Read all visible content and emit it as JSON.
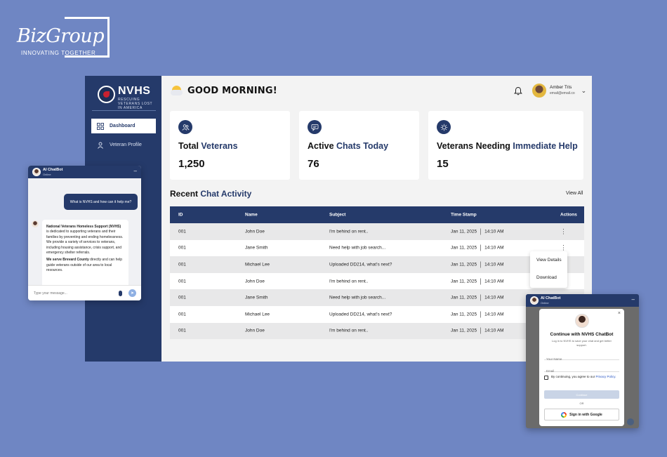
{
  "logo": {
    "brand": "BizGroup",
    "tagline": "INNOVATING TOGETHER"
  },
  "sidebar": {
    "org_name": "NVHS",
    "org_tagline": "RESCUING VETERANS LOST IN AMERICA",
    "items": [
      {
        "label": "Dashboard",
        "icon": "grid-icon",
        "active": true
      },
      {
        "label": "Veteran Profile",
        "icon": "person-icon",
        "active": false
      }
    ]
  },
  "header": {
    "greeting": "GOOD MORNING!",
    "user_name": "Amber Tris",
    "user_email": "email@email.co"
  },
  "cards": [
    {
      "label_plain": "Total ",
      "label_highlight": "Veterans",
      "value": "1,250",
      "icon": "people-icon"
    },
    {
      "label_plain": "Active ",
      "label_highlight": "Chats Today",
      "value": "76",
      "icon": "chat-icon"
    },
    {
      "label_plain": "Veterans Needing ",
      "label_highlight": "Immediate Help",
      "value": "15",
      "icon": "alert-icon"
    }
  ],
  "recent": {
    "title_plain": "Recent ",
    "title_highlight": "Chat Activity",
    "view_all": "View All"
  },
  "table": {
    "headers": {
      "id": "ID",
      "name": "Name",
      "subject": "Subject",
      "timestamp": "Time Stamp",
      "actions": "Actions"
    },
    "rows": [
      {
        "id": "001",
        "name": "John Doe",
        "subject": "I'm behind on rent..",
        "date": "Jan 11, 2025",
        "time": "14:10 AM"
      },
      {
        "id": "001",
        "name": "Jane Smith",
        "subject": "Need help with job search...",
        "date": "Jan 11, 2025",
        "time": "14:10 AM"
      },
      {
        "id": "001",
        "name": "Michael Lee",
        "subject": "Uploaded DD214, what's next?",
        "date": "Jan 11, 2025",
        "time": "14:10 AM"
      },
      {
        "id": "001",
        "name": "John Doe",
        "subject": "I'm behind on rent..",
        "date": "Jan 11, 2025",
        "time": "14:10 AM"
      },
      {
        "id": "001",
        "name": "Jane Smith",
        "subject": "Need help with job search...",
        "date": "Jan 11, 2025",
        "time": "14:10 AM"
      },
      {
        "id": "001",
        "name": "Michael Lee",
        "subject": "Uploaded DD214, what's next?",
        "date": "Jan 11, 2025",
        "time": "14:10 AM"
      },
      {
        "id": "001",
        "name": "John Doe",
        "subject": "I'm behind on rent..",
        "date": "Jan 11, 2025",
        "time": "14:10 AM"
      }
    ]
  },
  "context_menu": {
    "items": [
      "View Details",
      "Download"
    ]
  },
  "chatbot": {
    "title": "AI ChatBot",
    "status": "Online",
    "user_message": "What is NVHS and how can it help me?",
    "bot_paragraph_1_bold": "National Veterans Homeless Support (NVHS)",
    "bot_paragraph_1": " is dedicated to supporting veterans and their families by preventing and ending homelessness. We provide a variety of services to veterans, including housing assistance, crisis support, and emergency shelter referrals.",
    "bot_paragraph_2_bold": "We serve Brevard County",
    "bot_paragraph_2": " directly and can help guide veterans outside of our area to local resources.",
    "input_placeholder": "Type your message..."
  },
  "login_modal": {
    "title": "Continue with NVHS ChatBot",
    "subtitle": "Log in to NVHS to save your chat and get better support.",
    "name_placeholder": "Your Name",
    "email_placeholder": "Email",
    "agree_text": "By continuing, you agree to our ",
    "privacy_link": "Privacy Policy.",
    "continue_label": "Continue",
    "or_label": "OR",
    "google_label": "Sign in with Google"
  },
  "colors": {
    "background": "#6f86c3",
    "navy": "#253a6a",
    "accent_link": "#2a57c4"
  }
}
